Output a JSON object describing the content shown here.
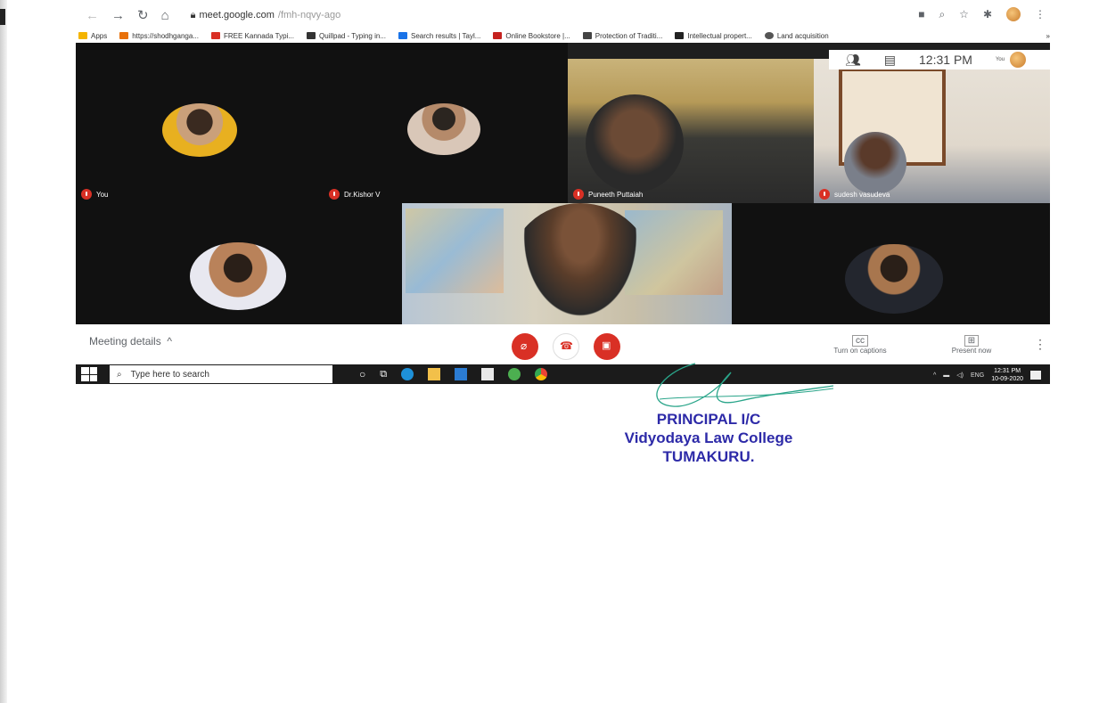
{
  "browser": {
    "url_host": "meet.google.com",
    "url_path": "/fmh-nqvy-ago",
    "bookmarks": [
      {
        "label": "Apps",
        "color": "#f4b400"
      },
      {
        "label": "https://shodhganga...",
        "color": "#e8710a"
      },
      {
        "label": "FREE Kannada Typi...",
        "color": "#d93025"
      },
      {
        "label": "Quillpad - Typing in...",
        "color": "#333333"
      },
      {
        "label": "Search results | Tayl...",
        "color": "#1a73e8"
      },
      {
        "label": "Online Bookstore |...",
        "color": "#c5221f"
      },
      {
        "label": "Protection of Traditi...",
        "color": "#444444"
      },
      {
        "label": "Intellectual propert...",
        "color": "#222222"
      },
      {
        "label": "Land acquisition",
        "color": "#555555"
      }
    ],
    "bookmarks_more": "»"
  },
  "meet_panel": {
    "time": "12:31 PM",
    "you_label": "You"
  },
  "participants": [
    {
      "name": "You"
    },
    {
      "name": "Dr.Kishor V"
    },
    {
      "name": "Puneeth Puttaiah"
    },
    {
      "name": "sudesh vasudeva"
    }
  ],
  "controls": {
    "meeting_details": "Meeting details",
    "captions_label": "Turn on captions",
    "captions_icon_text": "cc",
    "present_label": "Present now",
    "colors": {
      "red": "#d93025"
    }
  },
  "taskbar": {
    "search_placeholder": "Type here to search",
    "lang": "ENG",
    "time": "12:31 PM",
    "date": "10-09-2020"
  },
  "stamp": {
    "line1": "PRINCIPAL I/C",
    "line2": "Vidyodaya Law College",
    "line3": "TUMAKURU."
  }
}
